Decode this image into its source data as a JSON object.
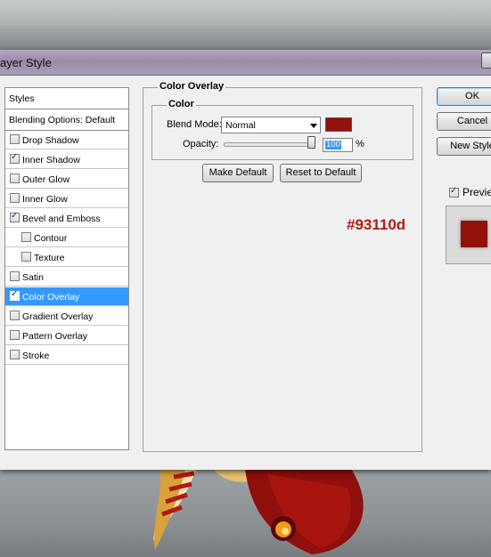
{
  "dialog": {
    "title": "ayer Style"
  },
  "sidebar": {
    "header": "Styles",
    "blending": "Blending Options: Default",
    "items": [
      {
        "label": "Drop Shadow",
        "checked": false
      },
      {
        "label": "Inner Shadow",
        "checked": true
      },
      {
        "label": "Outer Glow",
        "checked": false
      },
      {
        "label": "Inner Glow",
        "checked": false
      },
      {
        "label": "Bevel and Emboss",
        "checked": true
      },
      {
        "label": "Contour",
        "checked": false
      },
      {
        "label": "Texture",
        "checked": false
      },
      {
        "label": "Satin",
        "checked": false
      },
      {
        "label": "Color Overlay",
        "checked": true,
        "selected": true
      },
      {
        "label": "Gradient Overlay",
        "checked": false
      },
      {
        "label": "Pattern Overlay",
        "checked": false
      },
      {
        "label": "Stroke",
        "checked": false
      }
    ]
  },
  "panel": {
    "section_title": "Color Overlay",
    "group_title": "Color",
    "blend_mode_label": "Blend Mode:",
    "blend_mode_value": "Normal",
    "overlay_color": "#93110d",
    "opacity_label": "Opacity:",
    "opacity_value": "100",
    "opacity_unit": "%",
    "opacity_level": 1.0,
    "make_default": "Make Default",
    "reset_default": "Reset to Default",
    "hex_annotation": "#93110d"
  },
  "actions": {
    "ok": "OK",
    "cancel": "Cancel",
    "new_style": "New Style",
    "preview_label": "Preview",
    "preview_checked": true
  },
  "colors": {
    "accent_selection": "#3399ff",
    "annotation_text": "#b31b14"
  }
}
